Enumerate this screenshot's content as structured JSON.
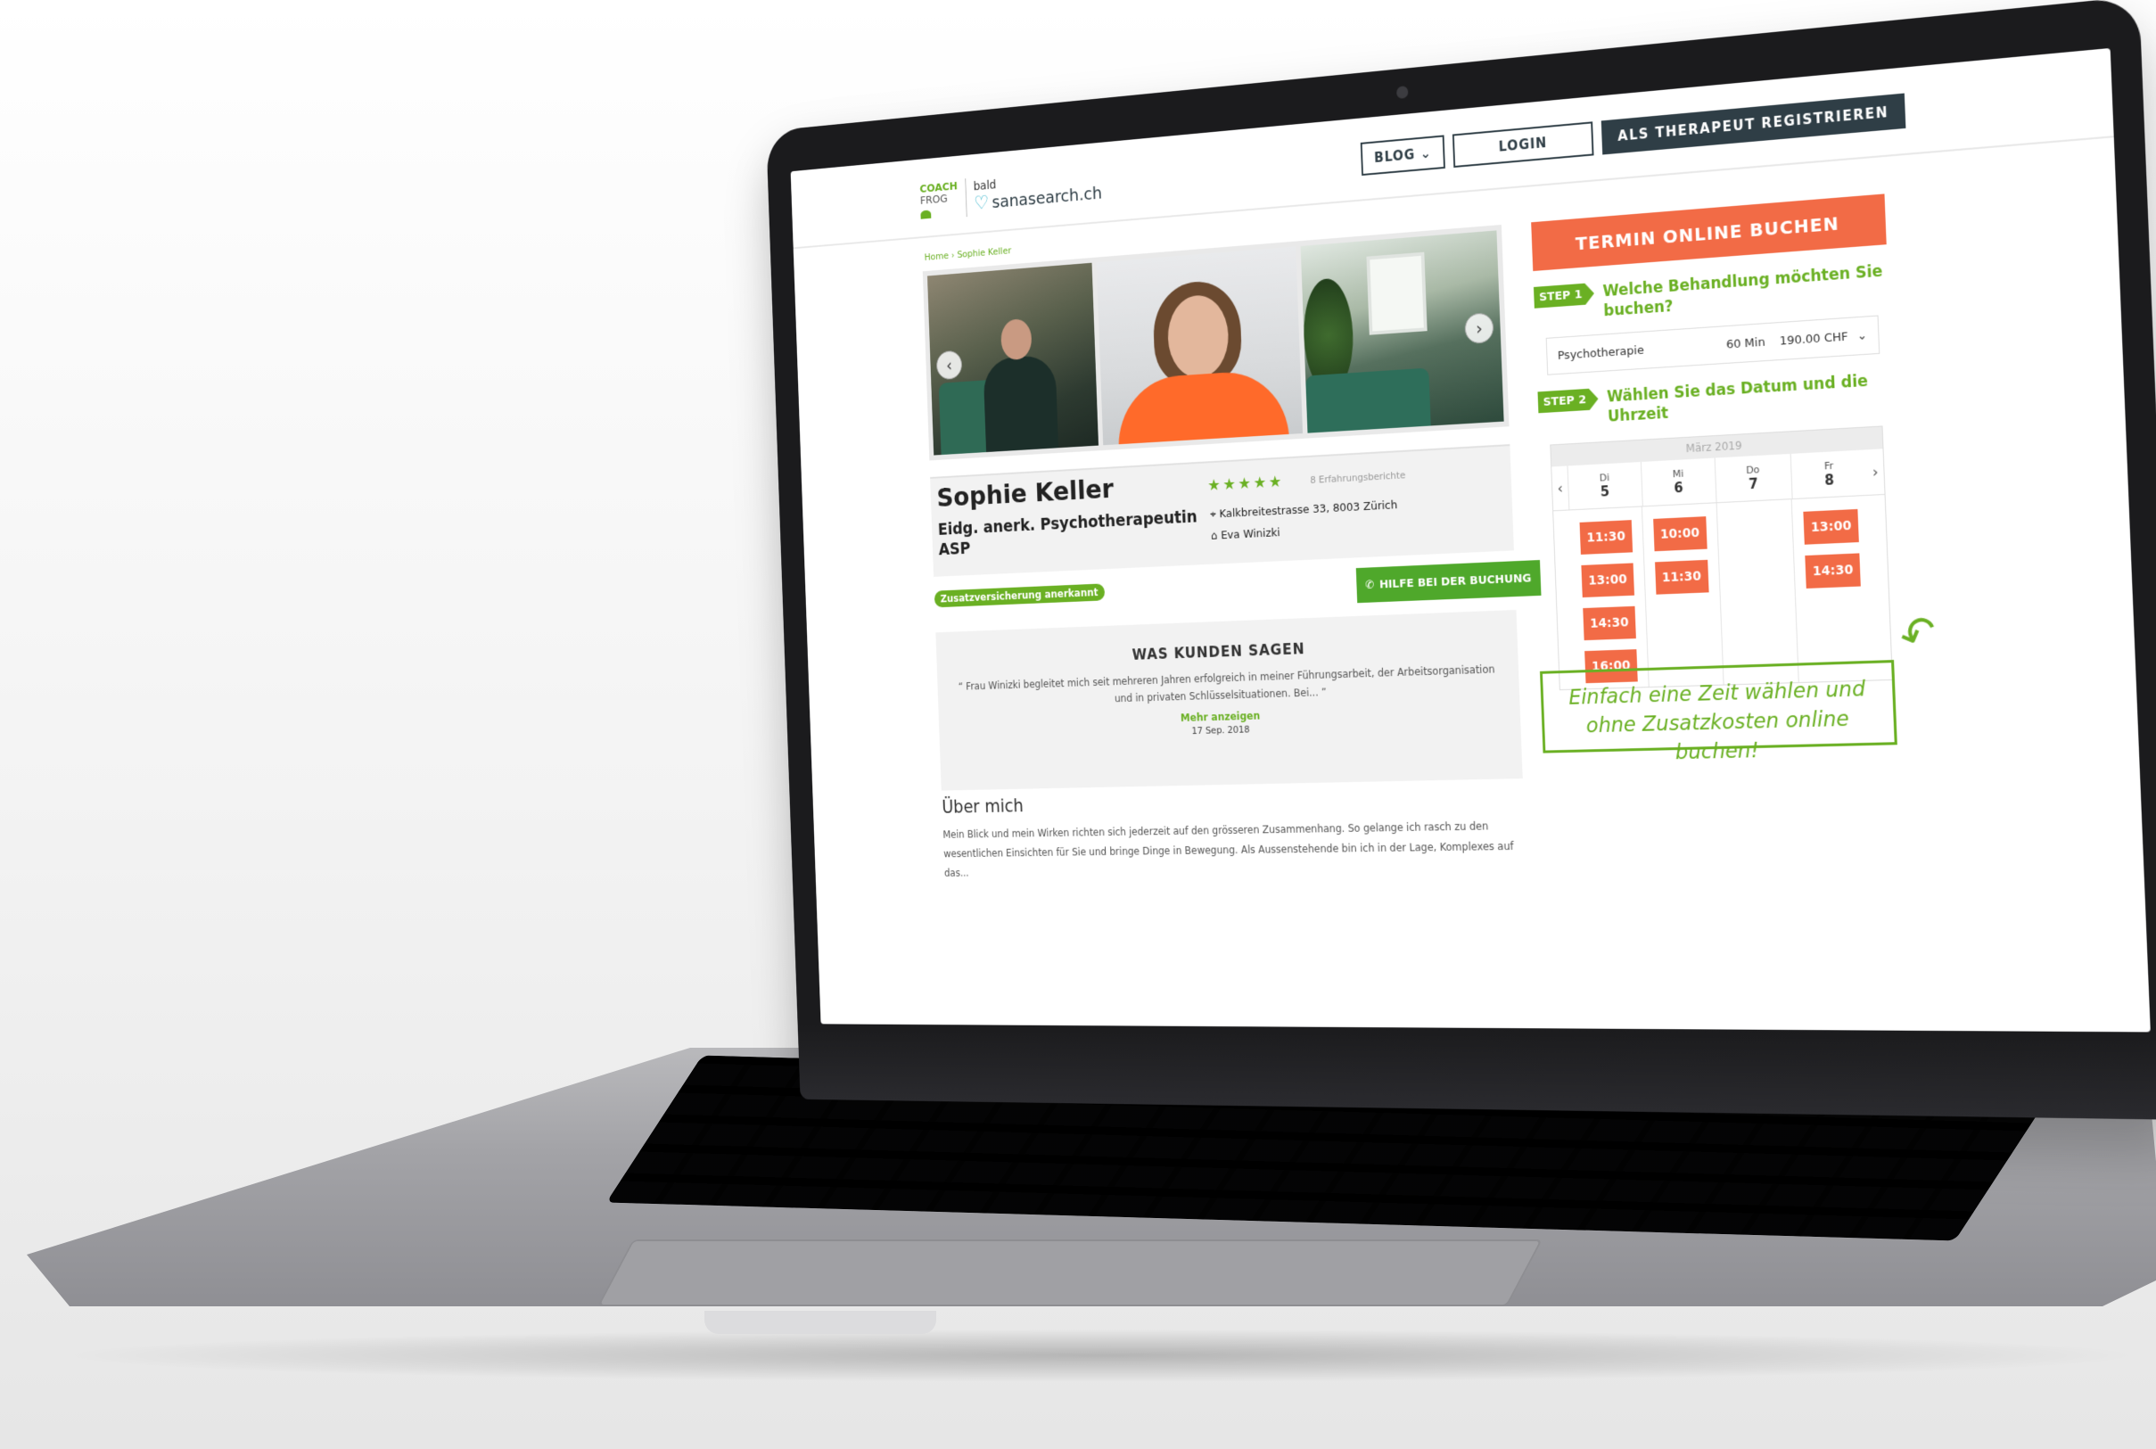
{
  "header": {
    "logo_coach": "COACH",
    "logo_frog": "FROG",
    "logo_bald": "bald",
    "logo_sana": "sanasearch.ch",
    "nav_blog": "BLOG",
    "nav_login": "LOGIN",
    "nav_register": "ALS THERAPEUT REGISTRIEREN"
  },
  "breadcrumb": "Home › Sophie Keller",
  "profile": {
    "name": "Sophie Keller",
    "title": "Eidg. anerk. Psychotherapeutin ASP",
    "rating_stars": "★★★★★",
    "rating_value": 5,
    "reviews": "8 Erfahrungsberichte",
    "address": "Kalkbreitestrasse 33, 8003 Zürich",
    "practice": "Eva Winizki",
    "insurance_badge": "Zusatzversicherung anerkannt",
    "help_button": "HILFE BEI DER BUCHUNG"
  },
  "testimonial": {
    "heading": "WAS KUNDEN SAGEN",
    "text": "“ Frau Winizki begleitet mich seit mehreren Jahren erfolgreich in meiner Führungsarbeit, der Arbeitsorganisation und in privaten Schlüsselsituationen. Bei... ”",
    "more": "Mehr anzeigen",
    "date": "17 Sep. 2018"
  },
  "about": {
    "heading": "Über mich",
    "text": "Mein Blick und mein Wirken richten sich jederzeit auf den grösseren Zusammenhang. So gelange ich rasch zu den wesentlichen Einsichten für Sie und bringe Dinge in Bewegung. Als Aussenstehende bin ich in der Lage, Komplexes auf das..."
  },
  "booking": {
    "heading": "TERMIN ONLINE BUCHEN",
    "step1_tag": "STEP 1",
    "step1_question": "Welche Behandlung möchten Sie buchen?",
    "treatment": "Psychotherapie",
    "duration": "60 Min",
    "price": "190.00 CHF",
    "step2_tag": "STEP 2",
    "step2_question": "Wählen Sie das Datum und die Uhrzeit",
    "month": "März 2019",
    "days": [
      {
        "name": "Di",
        "num": "5",
        "slots": [
          "11:30",
          "13:00",
          "14:30",
          "16:00"
        ]
      },
      {
        "name": "Mi",
        "num": "6",
        "slots": [
          "10:00",
          "11:30"
        ]
      },
      {
        "name": "Do",
        "num": "7",
        "slots": []
      },
      {
        "name": "Fr",
        "num": "8",
        "slots": [
          "13:00",
          "14:30"
        ]
      }
    ]
  },
  "tip": "Einfach eine Zeit wählen und ohne Zusatzkosten online buchen!",
  "colors": {
    "accent_orange": "#f26b46",
    "accent_green": "#6ab023",
    "dark": "#2f3e46"
  }
}
